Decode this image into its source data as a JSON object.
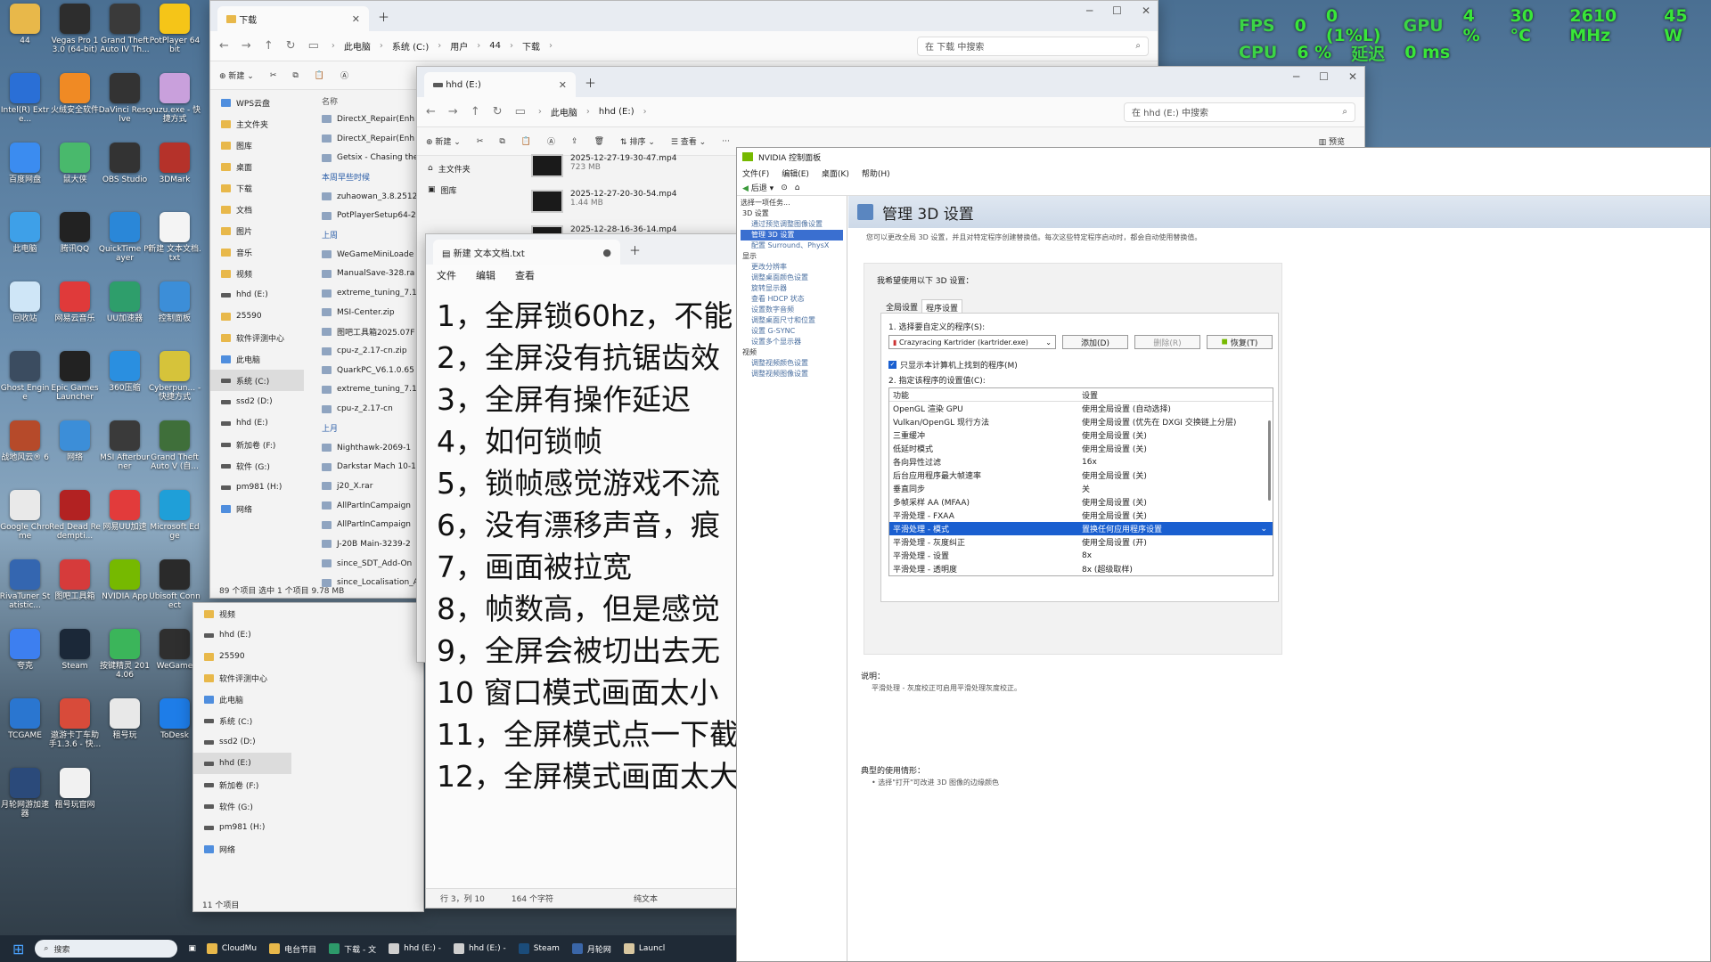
{
  "overlay": {
    "fps_label": "FPS",
    "fps_value": "0",
    "fps_low": "0 (1%L)",
    "gpu_label": "GPU",
    "gpu_usage": "4 %",
    "gpu_temp": "30 °C",
    "gpu_clock": "2610 MHz",
    "gpu_power": "45 W",
    "cpu_label": "CPU",
    "cpu_usage": "6 %",
    "latency_label": "延迟",
    "latency_value": "0 ms"
  },
  "desktop_icons": [
    {
      "label": "44",
      "color": "#e8b84a"
    },
    {
      "label": "Vegas Pro 13.0 (64-bit)",
      "color": "#2d2d2d"
    },
    {
      "label": "Grand Theft Auto IV Th...",
      "color": "#3a3a3a"
    },
    {
      "label": "PotPlayer 64 bit",
      "color": "#f5c518"
    },
    {
      "label": "Intel(R) Extre...",
      "color": "#2a6fd6"
    },
    {
      "label": "火绒安全软件",
      "color": "#f08a24"
    },
    {
      "label": "DaVinci Resolve",
      "color": "#333"
    },
    {
      "label": "yuzu.exe - 快捷方式",
      "color": "#c9a0dc"
    },
    {
      "label": "百度网盘",
      "color": "#3b8cf0"
    },
    {
      "label": "鼠大侠",
      "color": "#49b96c"
    },
    {
      "label": "OBS Studio",
      "color": "#333"
    },
    {
      "label": "3DMark",
      "color": "#b5322a"
    },
    {
      "label": "此电脑",
      "color": "#3ea0e8"
    },
    {
      "label": "腾讯QQ",
      "color": "#222"
    },
    {
      "label": "QuickTime Player",
      "color": "#2a87d8"
    },
    {
      "label": "新建 文本文档.txt",
      "color": "#f4f4f4"
    },
    {
      "label": "回收站",
      "color": "#cfe6f7"
    },
    {
      "label": "网易云音乐",
      "color": "#e03a3a"
    },
    {
      "label": "UU加速器",
      "color": "#2e9e6b"
    },
    {
      "label": "控制面板",
      "color": "#3c8ed8"
    },
    {
      "label": "Ghost Engine",
      "color": "#3b4c60"
    },
    {
      "label": "Epic Games Launcher",
      "color": "#222"
    },
    {
      "label": "360压缩",
      "color": "#2a8fe0"
    },
    {
      "label": "Cyberpun... - 快捷方式",
      "color": "#d6c33a"
    },
    {
      "label": "战地风云® 6",
      "color": "#b64a2a"
    },
    {
      "label": "网络",
      "color": "#3c8ed8"
    },
    {
      "label": "MSI Afterburner",
      "color": "#3a3a3a"
    },
    {
      "label": "Grand Theft Auto V (自...",
      "color": "#3f6f3a"
    },
    {
      "label": "Google Chrome",
      "color": "#e9e9e9"
    },
    {
      "label": "Red Dead Redempti...",
      "color": "#b22222"
    },
    {
      "label": "网易UU加速",
      "color": "#e23b3b"
    },
    {
      "label": "Microsoft Edge",
      "color": "#1f9fd8"
    },
    {
      "label": "RivaTuner Statistic...",
      "color": "#3466b0"
    },
    {
      "label": "图吧工具箱",
      "color": "#d63b3b"
    },
    {
      "label": "NVIDIA App",
      "color": "#76b900"
    },
    {
      "label": "Ubisoft Connect",
      "color": "#2a2a2a"
    },
    {
      "label": "夸克",
      "color": "#3d7ff0"
    },
    {
      "label": "Steam",
      "color": "#1b2838"
    },
    {
      "label": "按键精灵 2014.06",
      "color": "#3bb55a"
    },
    {
      "label": "WeGame",
      "color": "#2f2f2f"
    },
    {
      "label": "TCGAME",
      "color": "#2a76d0"
    },
    {
      "label": "遨游卡丁车助手1.3.6 - 快...",
      "color": "#d84b3a"
    },
    {
      "label": "租号玩",
      "color": "#e8e8e8"
    },
    {
      "label": "ToDesk",
      "color": "#1e7de8"
    },
    {
      "label": "月轮网游加速器",
      "color": "#2b4a7a"
    },
    {
      "label": "租号玩官网",
      "color": "#f1f1f1"
    }
  ],
  "explorer1": {
    "tab": "下载",
    "breadcrumb": [
      "此电脑",
      "系统 (C:)",
      "用户",
      "44",
      "下载"
    ],
    "search_placeholder": "在 下载 中搜索",
    "new_label": "新建",
    "nav": [
      {
        "label": "WPS云盘",
        "icon": "cloud-icon"
      },
      {
        "label": "主文件夹",
        "icon": "home-icon"
      },
      {
        "label": "图库",
        "icon": "gallery-icon"
      },
      {
        "label": "桌面",
        "icon": "folder-icon"
      },
      {
        "label": "下载",
        "icon": "folder-icon"
      },
      {
        "label": "文档",
        "icon": "folder-icon"
      },
      {
        "label": "图片",
        "icon": "folder-icon"
      },
      {
        "label": "音乐",
        "icon": "folder-icon"
      },
      {
        "label": "视频",
        "icon": "folder-icon"
      },
      {
        "label": "hhd (E:)",
        "icon": "drive-icon"
      },
      {
        "label": "25590",
        "icon": "folder-icon"
      },
      {
        "label": "软件评测中心",
        "icon": "folder-icon"
      },
      {
        "label": "此电脑",
        "icon": "pc-icon"
      },
      {
        "label": "系统 (C:)",
        "icon": "drive-icon"
      },
      {
        "label": "ssd2 (D:)",
        "icon": "drive-icon"
      },
      {
        "label": "hhd (E:)",
        "icon": "drive-icon"
      },
      {
        "label": "新加卷 (F:)",
        "icon": "drive-icon"
      },
      {
        "label": "软件 (G:)",
        "icon": "drive-icon"
      },
      {
        "label": "pm981 (H:)",
        "icon": "drive-icon"
      },
      {
        "label": "网络",
        "icon": "network-icon"
      }
    ],
    "column_name": "名称",
    "files": [
      "DirectX_Repair(Enh",
      "DirectX_Repair(Enh",
      "Getsix - Chasing the",
      "本周早些时候",
      "zuhaowan_3.8.2512",
      "PotPlayerSetup64-2",
      "上周",
      "WeGameMiniLoade",
      "ManualSave-328.ra",
      "extreme_tuning_7.1",
      "MSI-Center.zip",
      "图吧工具箱2025.07F",
      "cpu-z_2.17-cn.zip",
      "QuarkPC_V6.1.0.65",
      "extreme_tuning_7.1",
      "cpu-z_2.17-cn",
      "上月",
      "Nighthawk-2069-1",
      "Darkstar Mach 10-1",
      "j20_X.rar",
      "AllPartInCampaign",
      "AllPartInCampaign",
      "J-20B Main-3239-2",
      "since_SDT_Add-On",
      "since_Localisation_A"
    ],
    "status": "89 个项目    选中 1 个项目  9.78 MB"
  },
  "explorer2": {
    "tab": "hhd (E:)",
    "breadcrumb": [
      "此电脑",
      "hhd (E:)"
    ],
    "search_placeholder": "在 hhd (E:) 中搜索",
    "new_label": "新建",
    "sort_label": "排序",
    "view_label": "查看",
    "preview_label": "预览",
    "nav_home": "主文件夹",
    "nav_gallery": "图库",
    "files": [
      {
        "name": "2025-12-27-19-30-47.mp4",
        "size": "723 MB"
      },
      {
        "name": "2025-12-27-20-30-54.mp4",
        "size": "1.44 MB"
      },
      {
        "name": "2025-12-28-16-36-14.mp4",
        "size": ""
      }
    ]
  },
  "explorer3": {
    "nav": [
      {
        "label": "视频"
      },
      {
        "label": "hhd (E:)"
      },
      {
        "label": "25590"
      },
      {
        "label": "软件评测中心"
      },
      {
        "label": "此电脑"
      },
      {
        "label": "系统 (C:)"
      },
      {
        "label": "ssd2 (D:)"
      },
      {
        "label": "hhd (E:)"
      },
      {
        "label": "新加卷 (F:)"
      },
      {
        "label": "软件 (G:)"
      },
      {
        "label": "pm981 (H:)"
      },
      {
        "label": "网络"
      }
    ],
    "status": "11 个项目"
  },
  "notepad": {
    "tab": "新建 文本文档.txt",
    "menu": [
      "文件",
      "编辑",
      "查看"
    ],
    "lines": [
      "1，全屏锁60hz，不能",
      "2，全屏没有抗锯齿效",
      "3，全屏有操作延迟",
      "4，如何锁帧",
      "5，锁帧感觉游戏不流",
      "6，没有漂移声音，痕",
      "7，画面被拉宽",
      "8，帧数高，但是感觉",
      "9，全屏会被切出去无",
      "10 窗口模式画面太小",
      "11，全屏模式点一下截",
      "12，全屏模式画面太大"
    ],
    "status_pos": "行 3，列 10",
    "status_chars": "164 个字符",
    "status_type": "纯文本"
  },
  "nvidia": {
    "title": "NVIDIA 控制面板",
    "menu": [
      "文件(F)",
      "编辑(E)",
      "桌面(K)",
      "帮助(H)"
    ],
    "back_label": "后退",
    "task_header": "选择一项任务...",
    "tree": [
      {
        "label": "3D 设置",
        "kind": "h"
      },
      {
        "label": "通过预览调整图像设置",
        "kind": "n"
      },
      {
        "label": "管理 3D 设置",
        "kind": "sel"
      },
      {
        "label": "配置 Surround、PhysX",
        "kind": "n"
      },
      {
        "label": "显示",
        "kind": "h"
      },
      {
        "label": "更改分辨率",
        "kind": "n"
      },
      {
        "label": "调整桌面颜色设置",
        "kind": "n"
      },
      {
        "label": "旋转显示器",
        "kind": "n"
      },
      {
        "label": "查看 HDCP 状态",
        "kind": "n"
      },
      {
        "label": "设置数字音频",
        "kind": "n"
      },
      {
        "label": "调整桌面尺寸和位置",
        "kind": "n"
      },
      {
        "label": "设置 G-SYNC",
        "kind": "n"
      },
      {
        "label": "设置多个显示器",
        "kind": "n"
      },
      {
        "label": "视频",
        "kind": "h"
      },
      {
        "label": "调整视频颜色设置",
        "kind": "n"
      },
      {
        "label": "调整视频图像设置",
        "kind": "n"
      }
    ],
    "page_title": "管理 3D 设置",
    "description": "您可以更改全局 3D 设置，并且对特定程序创建替换值。每次这些特定程序启动时，都会自动使用替换值。",
    "prompt": "我希望使用以下 3D 设置：",
    "tab_global": "全局设置",
    "tab_program": "程序设置",
    "step1": "1. 选择要自定义的程序(S):",
    "program": "Crazyracing Kartrider (kartrider.exe)",
    "btn_add": "添加(D)",
    "btn_remove": "删除(R)",
    "btn_restore": "恢复(T)",
    "checkbox_label": "只显示本计算机上找到的程序(M)",
    "step2": "2. 指定该程序的设置值(C):",
    "col_feature": "功能",
    "col_setting": "设置",
    "rows": [
      {
        "f": "OpenGL 渲染 GPU",
        "s": "使用全局设置 (自动选择)",
        "sel": false
      },
      {
        "f": "Vulkan/OpenGL 现行方法",
        "s": "使用全局设置 (优先在 DXGI 交换链上分层)",
        "sel": false
      },
      {
        "f": "三重缓冲",
        "s": "使用全局设置 (关)",
        "sel": false
      },
      {
        "f": "低延时模式",
        "s": "使用全局设置 (关)",
        "sel": false
      },
      {
        "f": "各向异性过滤",
        "s": "16x",
        "sel": false
      },
      {
        "f": "后台应用程序最大帧速率",
        "s": "使用全局设置 (关)",
        "sel": false
      },
      {
        "f": "垂直同步",
        "s": "关",
        "sel": false
      },
      {
        "f": "多帧采样 AA (MFAA)",
        "s": "使用全局设置 (关)",
        "sel": false
      },
      {
        "f": "平滑处理 - FXAA",
        "s": "使用全局设置 (关)",
        "sel": false
      },
      {
        "f": "平滑处理 - 模式",
        "s": "置换任何应用程序设置",
        "sel": true
      },
      {
        "f": "平滑处理 - 灰度纠正",
        "s": "使用全局设置 (开)",
        "sel": false
      },
      {
        "f": "平滑处理 - 设置",
        "s": "8x",
        "sel": false
      },
      {
        "f": "平滑处理 - 透明度",
        "s": "8x (超级取样)",
        "sel": false
      }
    ],
    "desc_title": "说明：",
    "desc_text": "平滑处理 - 灰度校正可启用平滑处理灰度校正。",
    "usage_title": "典型的使用情形：",
    "usage_text": "• 选择\"打开\"可改进 3D 图像的边缘颜色"
  },
  "taskbar": {
    "search": "搜索",
    "items": [
      {
        "label": "CloudMu",
        "color": "#e8b84a"
      },
      {
        "label": "电台节目",
        "color": "#e8b84a"
      },
      {
        "label": "下载 - 文",
        "color": "#2d9a6a"
      },
      {
        "label": "hhd (E:) -",
        "color": "#cfcfcf"
      },
      {
        "label": "hhd (E:) -",
        "color": "#cfcfcf"
      },
      {
        "label": "Steam",
        "color": "#1b4c7a"
      },
      {
        "label": "月轮网",
        "color": "#3a66a8"
      },
      {
        "label": "Launcl",
        "color": "#d8c7a0"
      }
    ]
  }
}
